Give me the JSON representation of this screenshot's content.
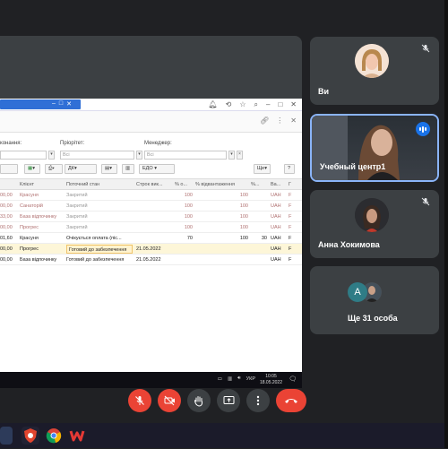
{
  "shared_app": {
    "filters": {
      "executor_label": "конання:",
      "priority_label": "Пріорітет:",
      "priority_value": "Всі",
      "manager_label": "Менеджер:",
      "manager_value": "Всі"
    },
    "commands": {
      "more_label": "Ще",
      "help_label": "?",
      "edo_label": "ЕДО",
      "dk_label": "ДК"
    },
    "grid": {
      "columns": [
        "Клієнт",
        "Поточний стан",
        "Строк вик...",
        "% о...",
        "% відвантаження",
        "%...",
        "Ва...",
        "Г"
      ],
      "rows": [
        {
          "amount": "00,00",
          "client": "Красуня",
          "state": "Закритий",
          "deadline": "",
          "p1": "100",
          "p2": "100",
          "p3": "",
          "cur": "UAH",
          "flag": "F"
        },
        {
          "amount": "00,00",
          "client": "Санаторій",
          "state": "Закритий",
          "deadline": "",
          "p1": "100",
          "p2": "100",
          "p3": "",
          "cur": "UAH",
          "flag": "F"
        },
        {
          "amount": "33,00",
          "client": "База відпочинку",
          "state": "Закритий",
          "deadline": "",
          "p1": "100",
          "p2": "100",
          "p3": "",
          "cur": "UAH",
          "flag": "F"
        },
        {
          "amount": "00,00",
          "client": "Прогрес",
          "state": "Закритий",
          "deadline": "",
          "p1": "100",
          "p2": "100",
          "p3": "",
          "cur": "UAH",
          "flag": "F"
        },
        {
          "amount": "01,60",
          "client": "Красуня",
          "state": "Очікується оплата (піс...",
          "deadline": "",
          "p1": "70",
          "p2": "100",
          "p3": "30",
          "cur": "UAH",
          "flag": "F"
        },
        {
          "amount": "00,00",
          "client": "Прогрес",
          "state": "Готовий до забезпечення",
          "deadline": "21.05.2022",
          "p1": "",
          "p2": "",
          "p3": "",
          "cur": "UAH",
          "flag": "F"
        },
        {
          "amount": "00,00",
          "client": "База відпочинку",
          "state": "Готовий до забезпечення",
          "deadline": "21.05.2022",
          "p1": "",
          "p2": "",
          "p3": "",
          "cur": "UAH",
          "flag": "F"
        }
      ]
    },
    "taskbar": {
      "lang": "УКР",
      "time": "10:05",
      "date": "18.05.2022"
    }
  },
  "participants": [
    {
      "name": "Ви",
      "muted": true
    },
    {
      "name": "Учебный центр1",
      "speaking": true
    },
    {
      "name": "Анна Хокимова",
      "muted": true
    },
    {
      "name": "Ще 31 особа",
      "initial": "A"
    }
  ],
  "colors": {
    "end_call": "#ea4335",
    "accent": "#8ab4f8",
    "tile_bg": "#3c4043",
    "background": "#202124"
  }
}
